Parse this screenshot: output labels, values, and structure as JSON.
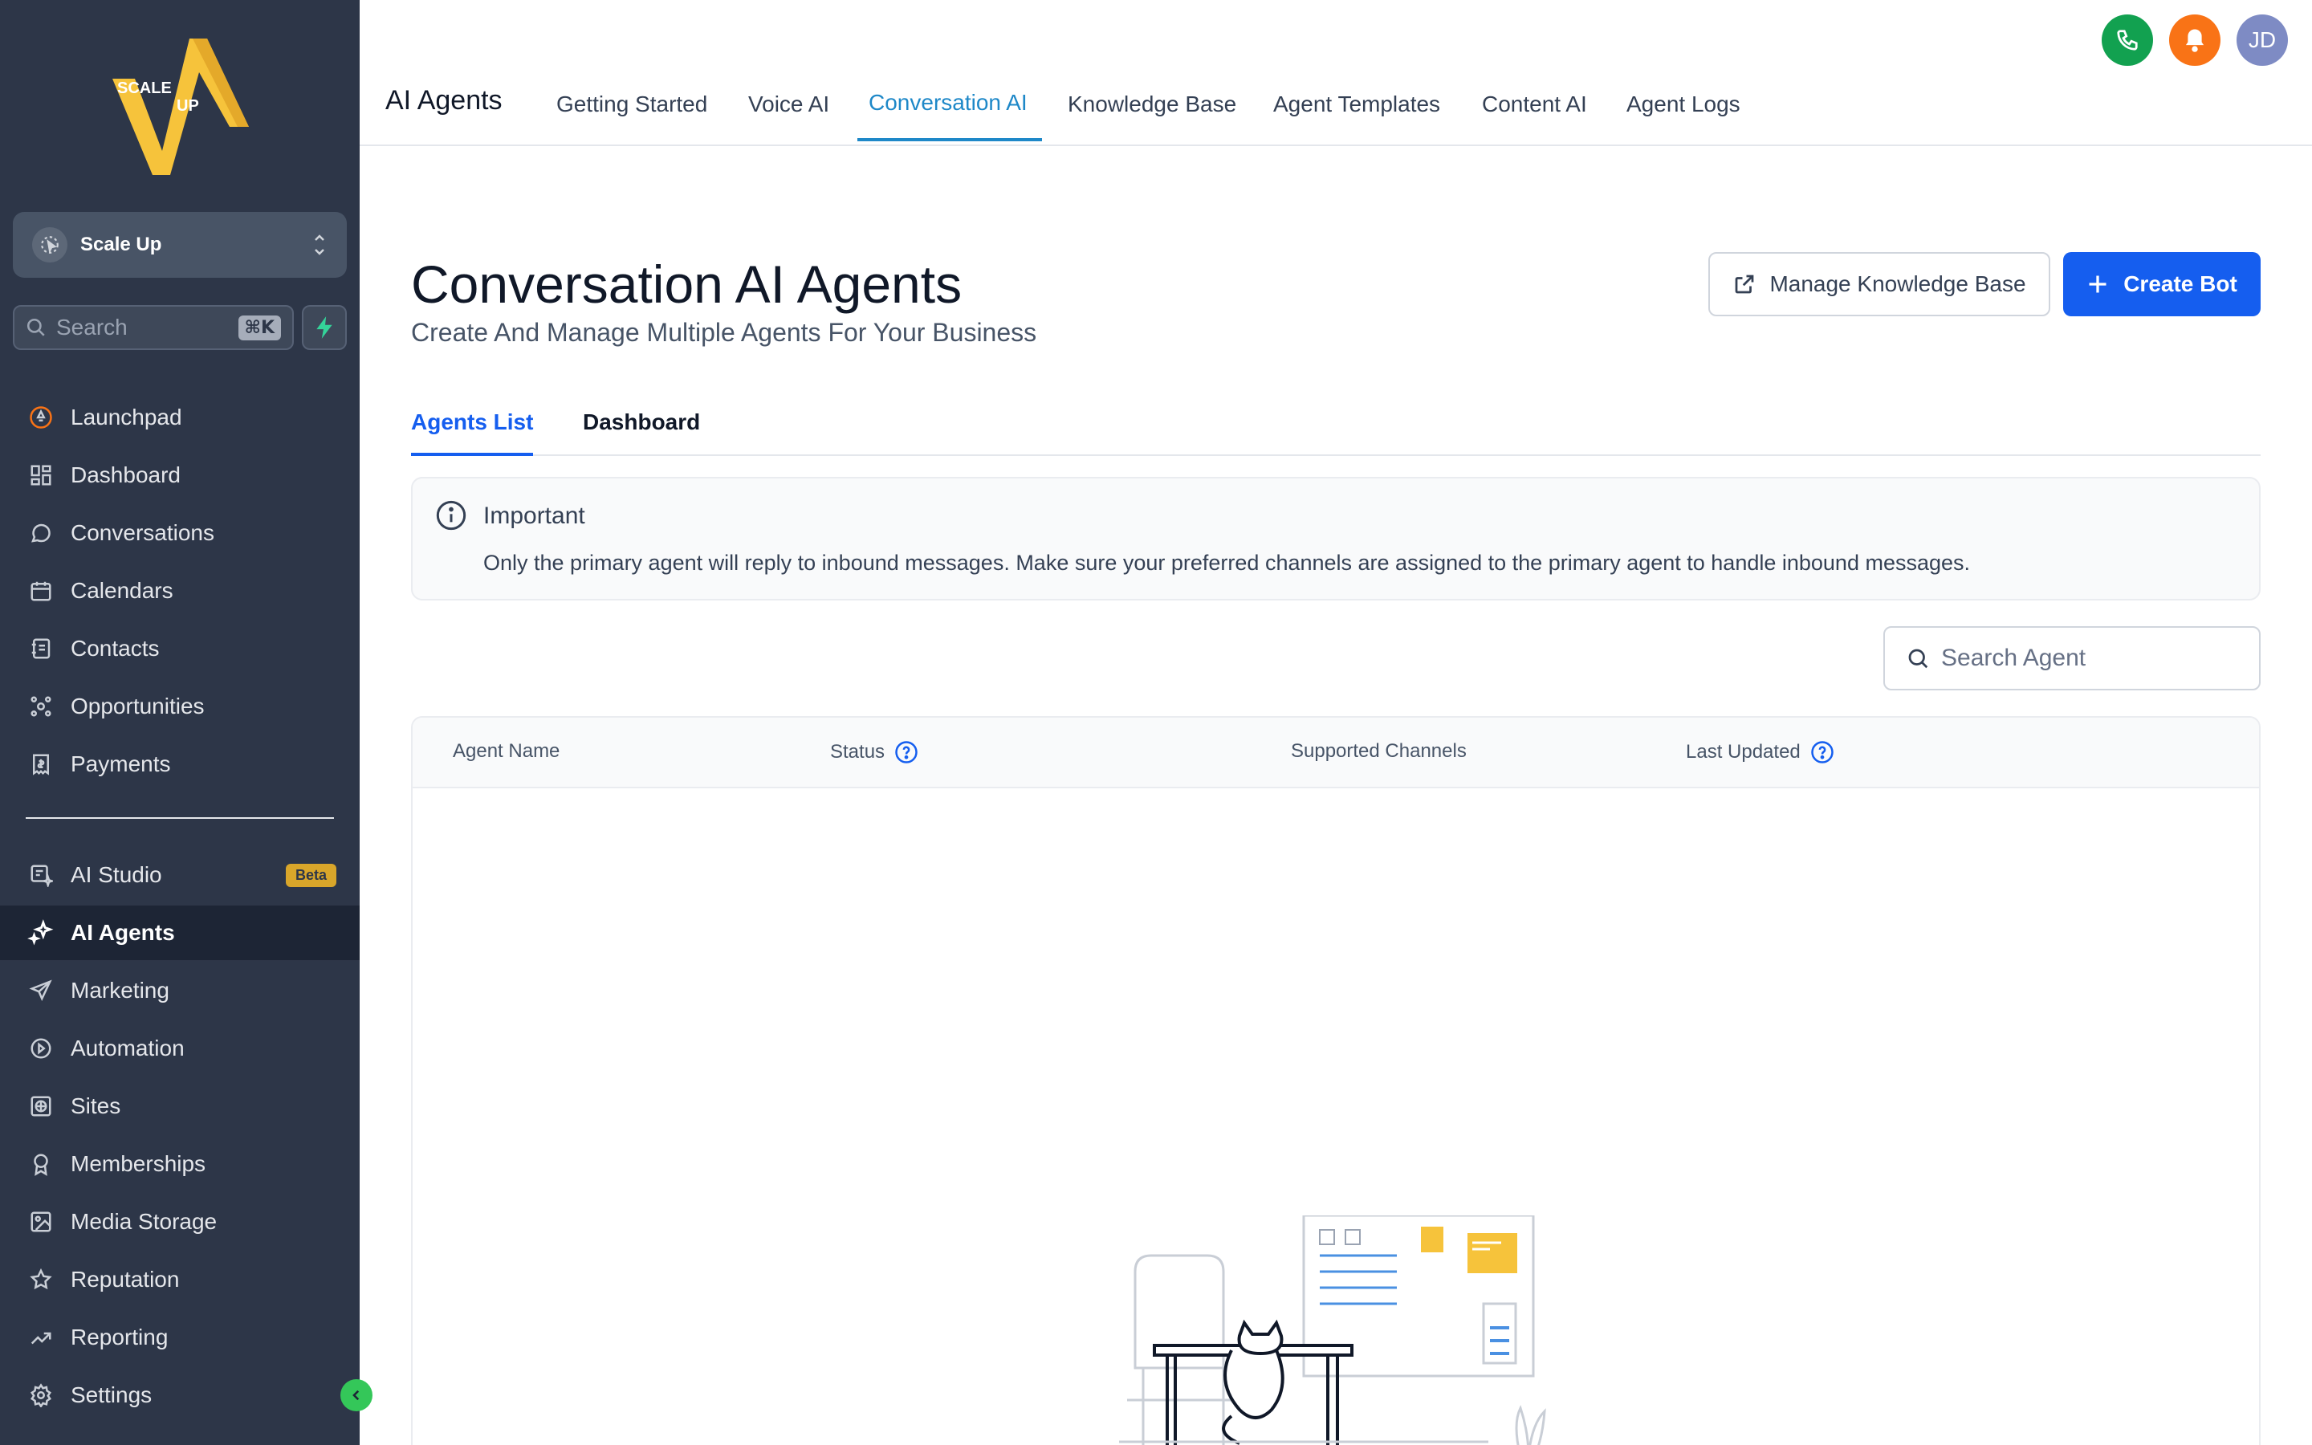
{
  "sidebar": {
    "logo_text": [
      "SCALE",
      "UP"
    ],
    "location": {
      "name": "Scale Up"
    },
    "search": {
      "placeholder": "Search",
      "shortcut": "⌘K"
    },
    "items": [
      {
        "label": "Launchpad",
        "icon": "rocket-icon"
      },
      {
        "label": "Dashboard",
        "icon": "dashboard-grid-icon"
      },
      {
        "label": "Conversations",
        "icon": "chat-bubble-icon"
      },
      {
        "label": "Calendars",
        "icon": "calendar-icon"
      },
      {
        "label": "Contacts",
        "icon": "address-book-icon"
      },
      {
        "label": "Opportunities",
        "icon": "pipeline-icon"
      },
      {
        "label": "Payments",
        "icon": "receipt-dollar-icon"
      }
    ],
    "items2": [
      {
        "label": "AI Studio",
        "icon": "ai-studio-icon",
        "badge": "Beta"
      },
      {
        "label": "AI Agents",
        "icon": "sparkles-icon",
        "active": true
      },
      {
        "label": "Marketing",
        "icon": "send-icon"
      },
      {
        "label": "Automation",
        "icon": "automation-icon"
      },
      {
        "label": "Sites",
        "icon": "globe-icon"
      },
      {
        "label": "Memberships",
        "icon": "award-icon"
      },
      {
        "label": "Media Storage",
        "icon": "image-icon"
      },
      {
        "label": "Reputation",
        "icon": "star-icon"
      },
      {
        "label": "Reporting",
        "icon": "trend-up-icon"
      },
      {
        "label": "Settings",
        "icon": "gear-icon"
      }
    ]
  },
  "topbar": {
    "title": "AI Agents",
    "tabs": [
      {
        "label": "Getting Started"
      },
      {
        "label": "Voice AI"
      },
      {
        "label": "Conversation AI",
        "active": true
      },
      {
        "label": "Knowledge Base"
      },
      {
        "label": "Agent Templates"
      },
      {
        "label": "Content AI"
      },
      {
        "label": "Agent Logs"
      }
    ],
    "avatar_initials": "JD",
    "colors": {
      "phone": "#12a150",
      "bell": "#f97316",
      "avatar": "#7e8bc4"
    }
  },
  "main": {
    "title": "Conversation AI Agents",
    "subtitle": "Create And Manage Multiple Agents For Your Business",
    "manage_kb_label": "Manage Knowledge Base",
    "create_bot_label": "Create Bot",
    "subtabs": [
      {
        "label": "Agents List",
        "active": true
      },
      {
        "label": "Dashboard"
      }
    ],
    "alert": {
      "title": "Important",
      "text": "Only the primary agent will reply to inbound messages. Make sure your preferred channels are assigned to the primary agent to handle inbound messages."
    },
    "search_placeholder": "Search Agent",
    "table": {
      "columns": [
        "Agent Name",
        "Status",
        "Supported Channels",
        "Last Updated"
      ]
    }
  },
  "colors": {
    "sidebar_bg": "#2d3648",
    "primary": "#155eef",
    "accent_tab": "#1e88c8"
  }
}
